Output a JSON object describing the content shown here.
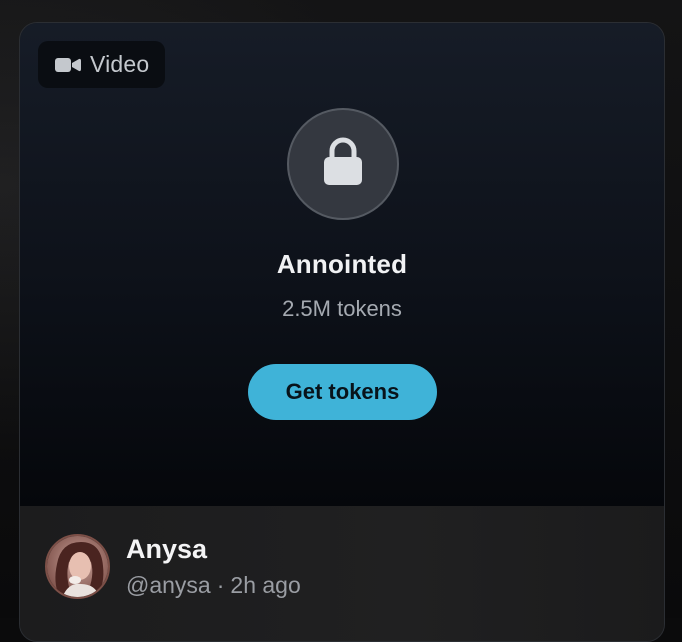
{
  "media": {
    "badge_icon": "video-camera-icon",
    "badge_label": "Video",
    "lock_icon": "lock-icon",
    "title": "Annointed",
    "price": "2.5M tokens",
    "cta_label": "Get tokens"
  },
  "author": {
    "name": "Anysa",
    "handle": "@anysa",
    "separator": "·",
    "time": "2h ago"
  },
  "colors": {
    "accent": "#3fb3d8",
    "card_border": "#2b2e33",
    "lock_circle": "#343840"
  }
}
